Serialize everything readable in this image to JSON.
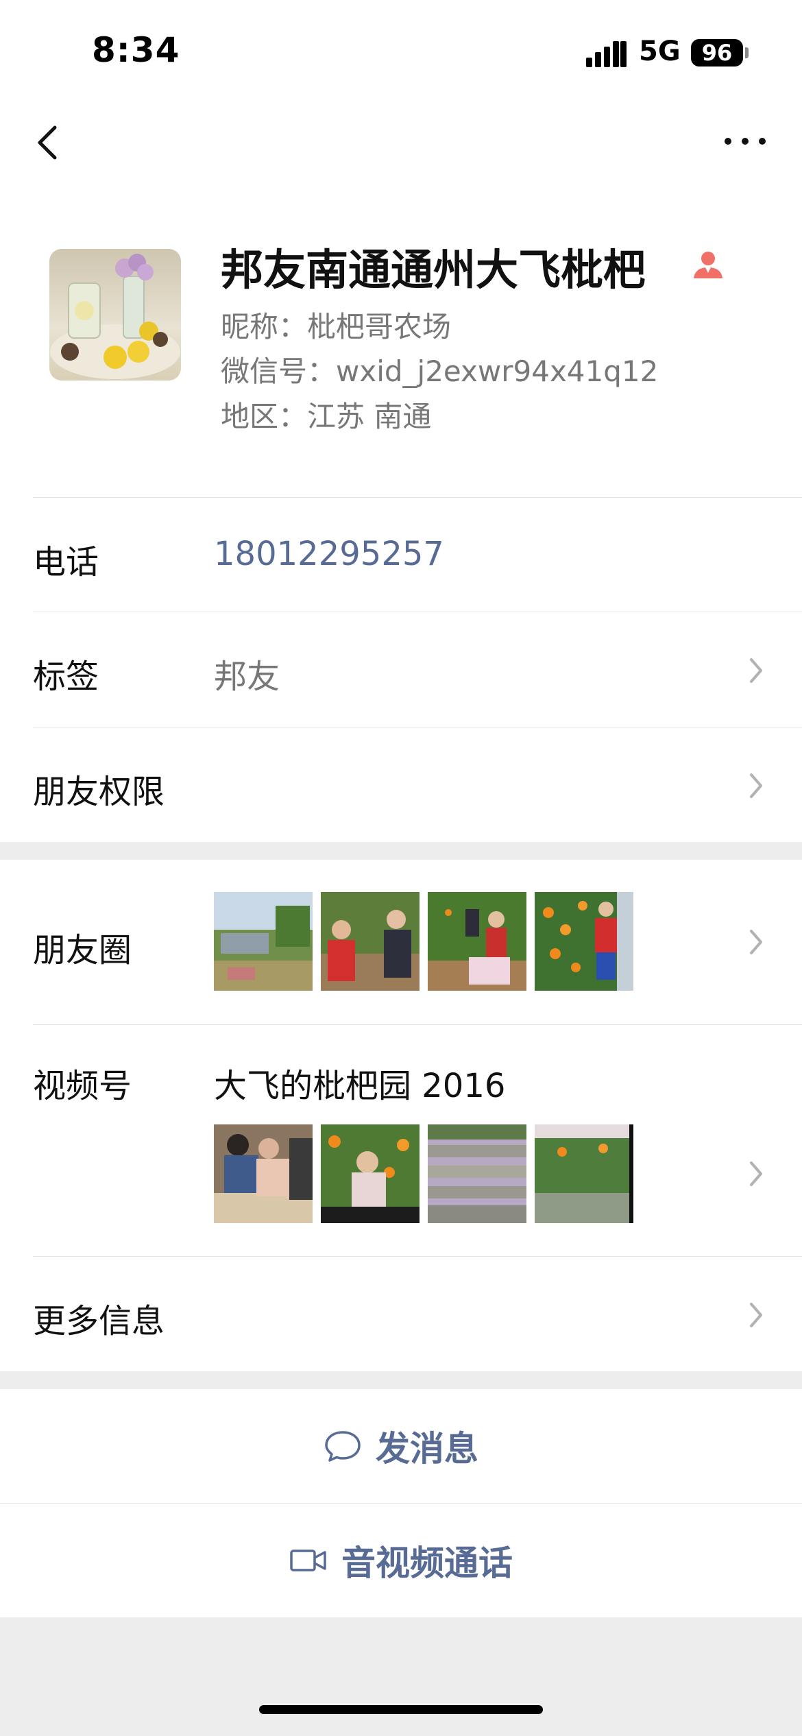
{
  "status_bar": {
    "time": "8:34",
    "network": "5G",
    "battery": "96"
  },
  "nav": {
    "back_icon": "chevron-left-icon",
    "more_icon": "more-dots-icon"
  },
  "profile": {
    "name": "邦友南通通州大飞枇杷",
    "gender_icon": "female-user-icon",
    "nickname": "昵称：枇杷哥农场",
    "wechat_id": "微信号：wxid_j2exwr94x41q12",
    "region": "地区：江苏 南通"
  },
  "rows": {
    "phone": {
      "label": "电话",
      "value": "18012295257"
    },
    "tags": {
      "label": "标签",
      "value": "邦友"
    },
    "permissions": {
      "label": "朋友权限"
    },
    "moments": {
      "label": "朋友圈"
    },
    "channels": {
      "label": "视频号",
      "value": "大飞的枇杷园 2016"
    },
    "more_info": {
      "label": "更多信息"
    }
  },
  "actions": {
    "message": {
      "label": "发消息",
      "icon": "chat-bubble-icon"
    },
    "call": {
      "label": "音视频通话",
      "icon": "video-camera-icon"
    }
  },
  "colors": {
    "link": "#576b95",
    "accent_red": "#f07067"
  }
}
